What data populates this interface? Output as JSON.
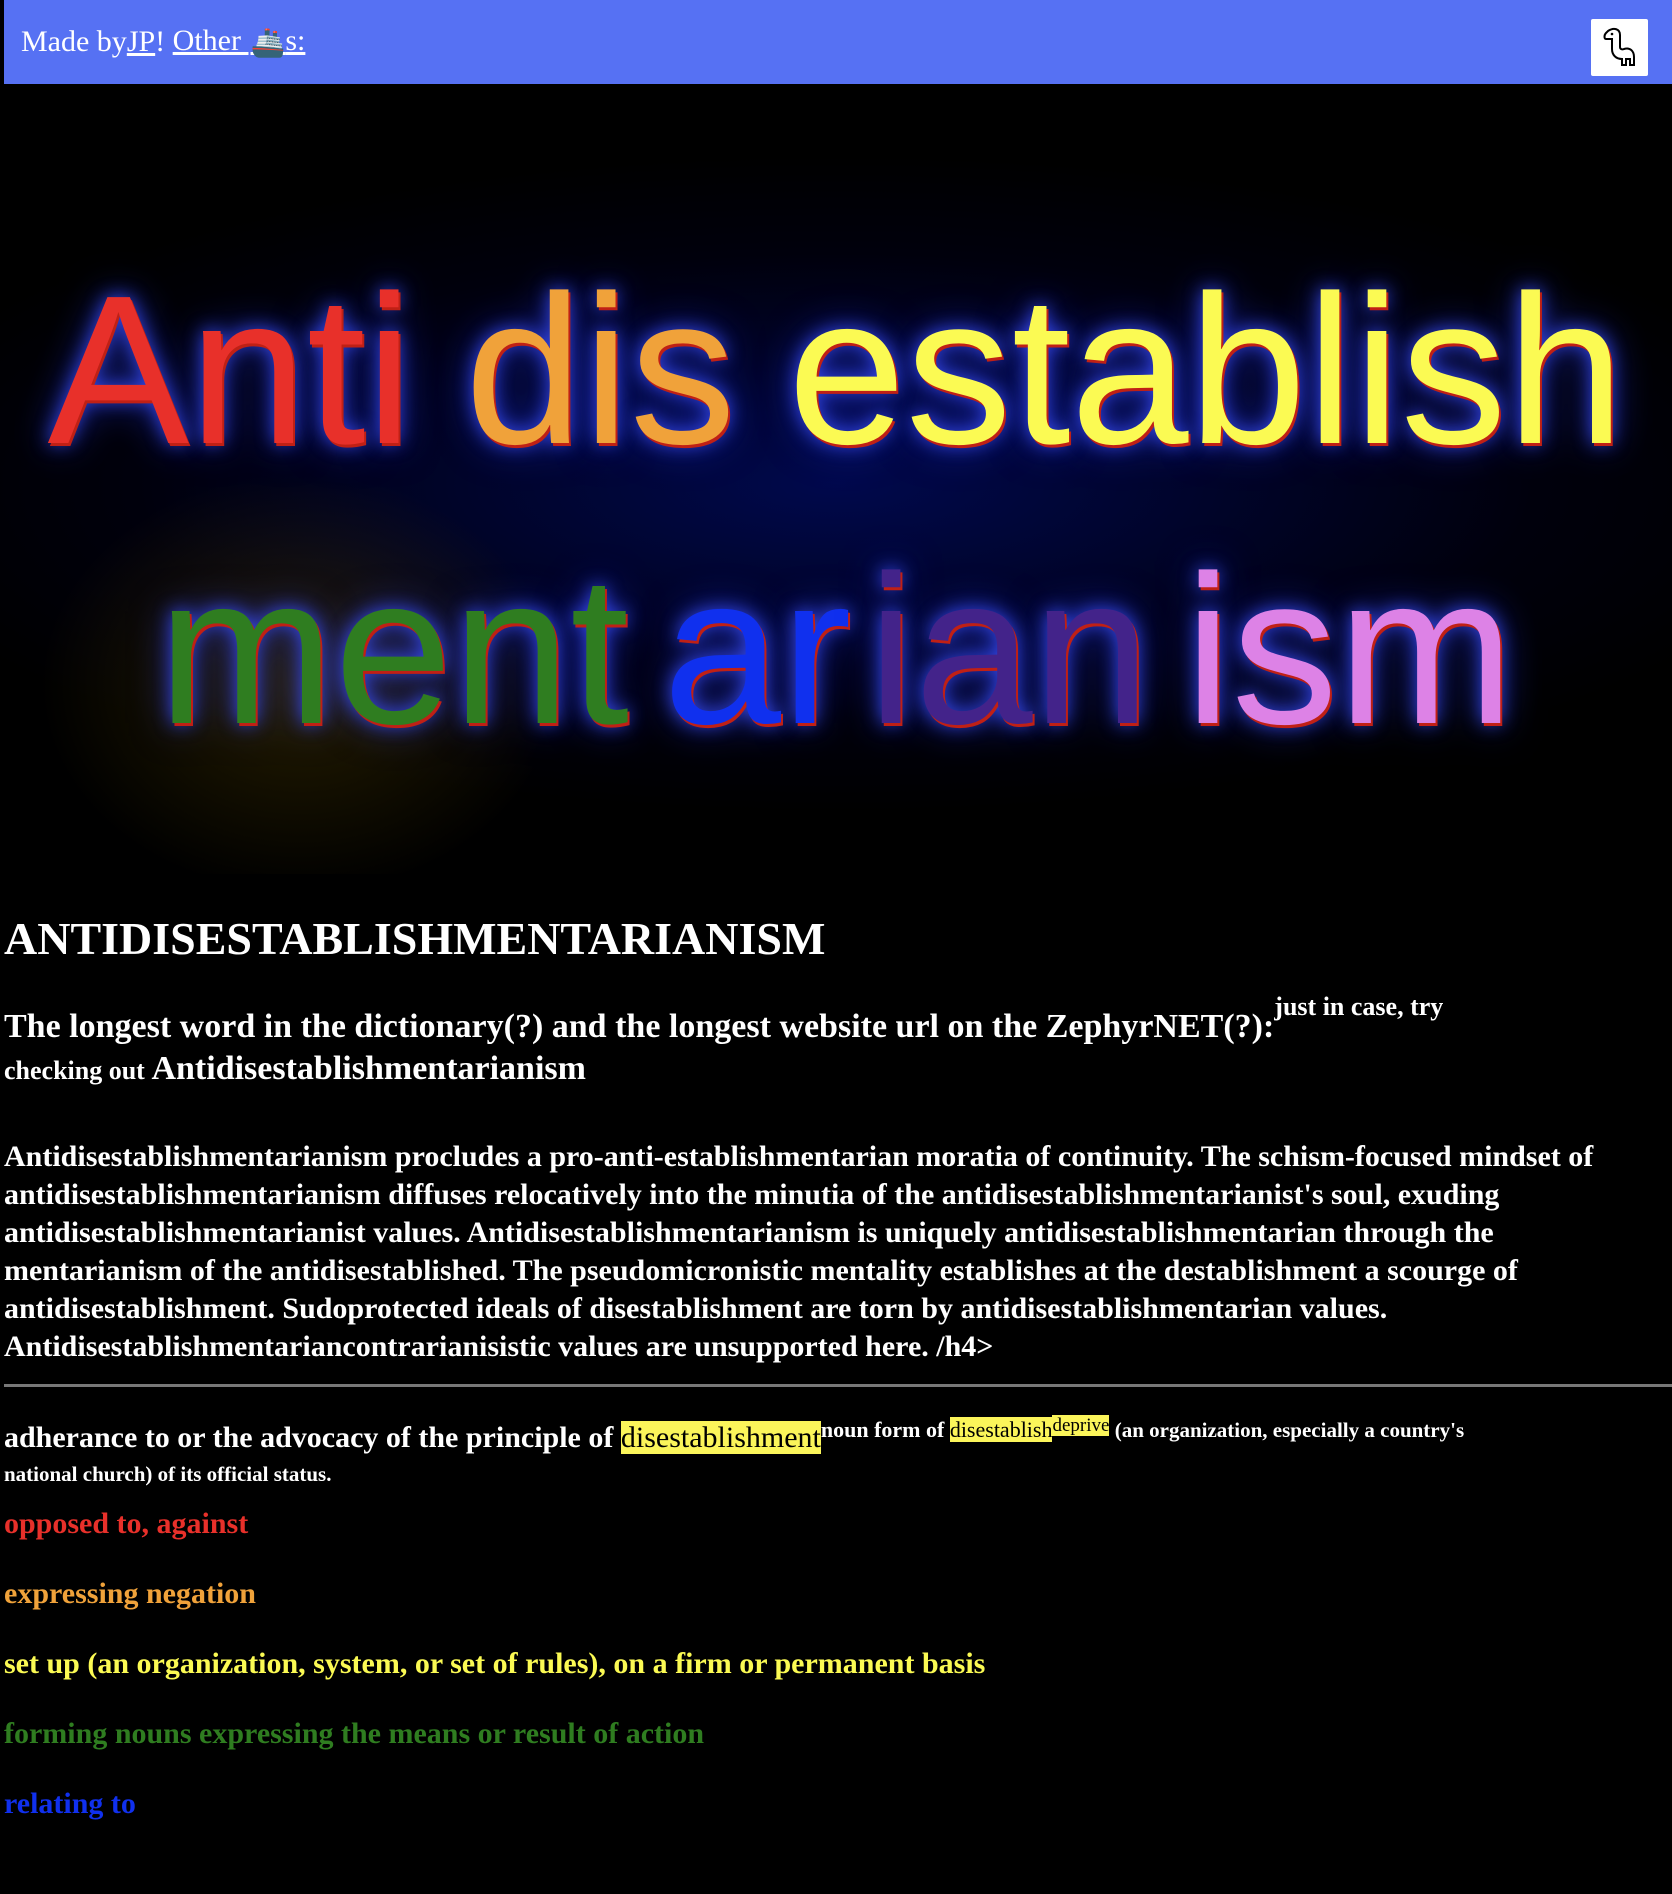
{
  "topbar": {
    "prefix": "Made by ",
    "author_link": "JP",
    "exclaim": "! ",
    "other_link": "Other ",
    "ship_icon": "🚢",
    "other_suffix": "s:",
    "dino_icon": "dinosaur-icon"
  },
  "hero": {
    "line1": [
      {
        "text": "Anti",
        "color": "#e8302a"
      },
      {
        "text": "dis",
        "color": "#f0a23a"
      },
      {
        "text": "establish",
        "color": "#fbfa53"
      }
    ],
    "line2": [
      {
        "text": "ment",
        "color": "#2f7d20"
      },
      {
        "text": "ar",
        "color": "#1030ee"
      },
      {
        "text": "ian",
        "color": "#43238a"
      },
      {
        "text": "ism",
        "color": "#dd82e6"
      }
    ]
  },
  "main": {
    "title": "ANTIDISESTABLISHMENTARIANISM",
    "subtitle": "The longest word in the dictionary(?) and the longest website url on the ZephyrNET(?):",
    "subtitle_sup": "just in case, try",
    "subtitle_checking": "checking out",
    "subtitle_word": "Antidisestablishmentarianism",
    "essay": "Antidisestablishmentarianism procludes a pro-anti-establishmentarian moratia of continuity. The schism-focused mindset of antidisestablishmentarianism diffuses relocatively into the minutia of the antidisestablishmentarianist's soul, exuding antidisestablishmentarianist values. Antidisestablishmentarianism is uniquely antidisestablishmentarian through the mentarianism of the antidisestablished. The pseudomicronistic mentality establishes at the destablishment a scourge of antidisestablishment. Sudoprotected ideals of disestablishment are torn by antidisestablishmentarian values. Antidisestablishmentariancontrarianisistic values are unsupported here. /h4>"
  },
  "definition": {
    "lead": "adherance to or the advocacy of the principle of ",
    "highlight1": "disestablishment",
    "sup1": "noun form of ",
    "highlight2": "disestablish",
    "sup2": "deprive",
    "tail1": " (an organization, especially a country's",
    "tail2": "national church) of its official status."
  },
  "parts": [
    {
      "text": "opposed to, against",
      "color": "#e8302a"
    },
    {
      "text": "expressing negation",
      "color": "#f0a23a"
    },
    {
      "text": "set up (an organization, system, or set of rules), on a firm or permanent basis",
      "color": "#fbfa53"
    },
    {
      "text": "forming nouns expressing the means or result of action",
      "color": "#2f7d20"
    },
    {
      "text": "relating to",
      "color": "#1030ee"
    }
  ]
}
